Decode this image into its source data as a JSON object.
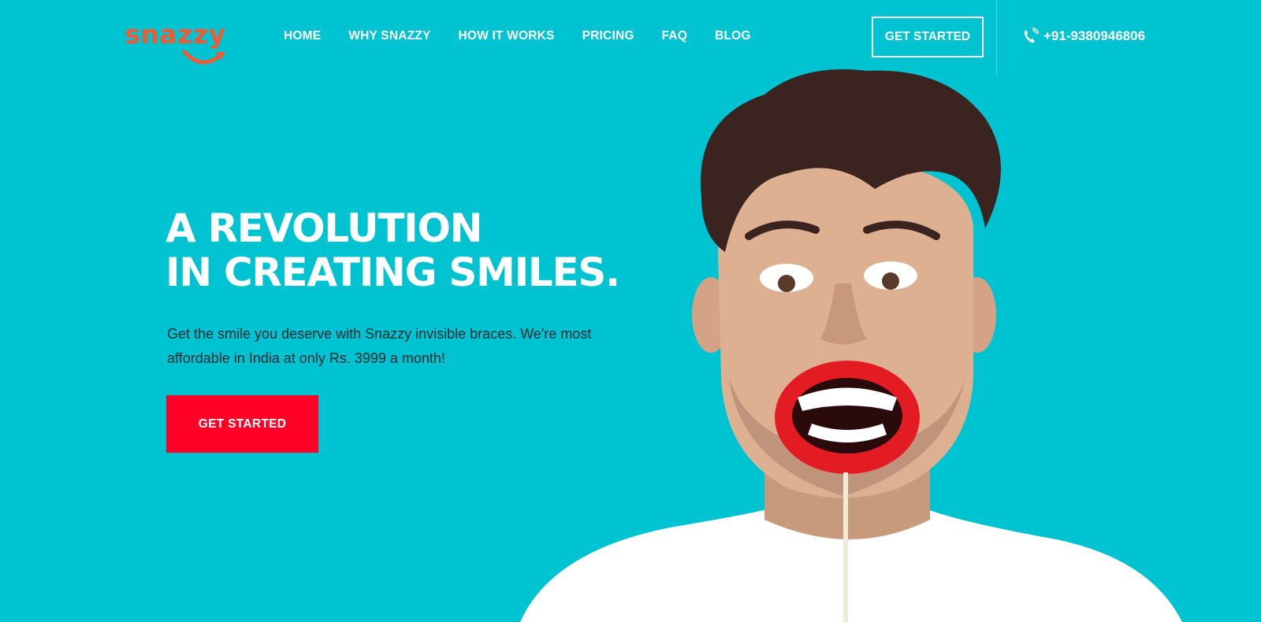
{
  "brand": {
    "name": "snazzy",
    "logo_color": "#f05a32"
  },
  "nav": {
    "items": [
      {
        "label": "HOME"
      },
      {
        "label": "WHY SNAZZY"
      },
      {
        "label": "HOW IT WORKS"
      },
      {
        "label": "PRICING"
      },
      {
        "label": "FAQ"
      },
      {
        "label": "BLOG"
      }
    ]
  },
  "header": {
    "cta_label": "GET STARTED",
    "phone_icon": "phone-icon",
    "phone_number": "+91-9380946806"
  },
  "hero": {
    "title_line1": "A REVOLUTION",
    "title_line2": "IN CREATING SMILES.",
    "subtitle": "Get the smile you deserve with Snazzy invisible braces. We're most affordable in India at only Rs. 3999 a month!",
    "cta_label": "GET STARTED",
    "image": "man-holding-lips-prop-photo"
  },
  "colors": {
    "background": "#00c3d2",
    "accent_red": "#ff0026",
    "text_dark": "#1a2a30",
    "white": "#ffffff"
  }
}
